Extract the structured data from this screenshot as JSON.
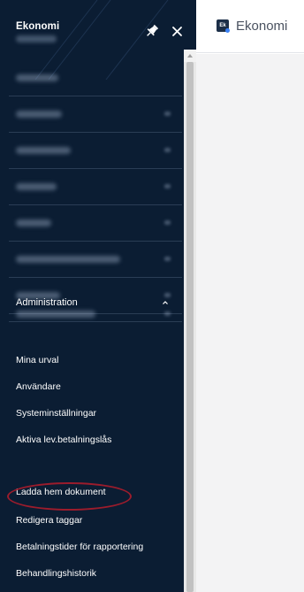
{
  "sidebar": {
    "title": "Ekonomi",
    "admin_section": {
      "label": "Administration",
      "items": [
        {
          "label": "Mina urval"
        },
        {
          "label": "Användare"
        },
        {
          "label": "Systeminställningar"
        },
        {
          "label": "Aktiva lev.betalningslås"
        },
        {
          "label": "Ladda hem dokument"
        },
        {
          "label": "Redigera taggar"
        },
        {
          "label": "Betalningstider för rapportering"
        },
        {
          "label": "Behandlingshistorik"
        }
      ]
    },
    "highlighted_item": "Ladda hem dokument"
  },
  "topbar": {
    "logo_text": "Ek",
    "title": "Ekonomi"
  },
  "colors": {
    "sidebar_bg": "#0b1d33",
    "highlight": "#9b1c2c",
    "content_bg": "#f3f3f4"
  },
  "icons": [
    "pin-icon",
    "close-icon",
    "chevron-up-icon",
    "app-logo-icon"
  ]
}
